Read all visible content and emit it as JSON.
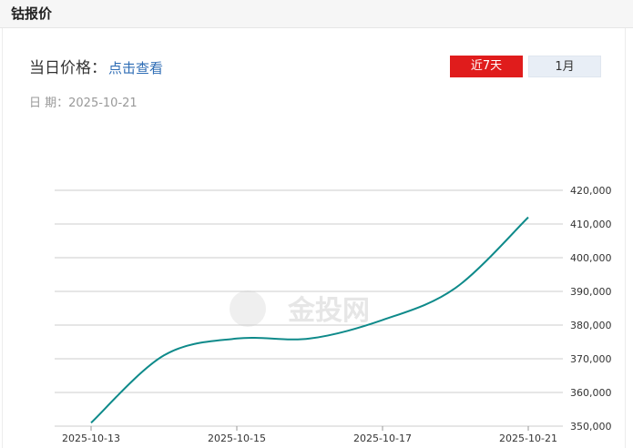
{
  "header": {
    "title": "钴报价"
  },
  "price": {
    "label": "当日价格：",
    "link": "点击查看"
  },
  "date": {
    "label": "日 期：",
    "value": "2025-10-21"
  },
  "range_buttons": [
    {
      "label": "近7天",
      "active": true
    },
    {
      "label": "1月",
      "active": false
    }
  ],
  "watermark": {
    "text": "金投网"
  },
  "colors": {
    "line": "#0e8a8a",
    "active": "#e01c1c",
    "link": "#2f6db5"
  },
  "chart_data": {
    "type": "line",
    "title": "",
    "xlabel": "",
    "ylabel": "",
    "x": [
      "2025-10-13",
      "2025-10-14",
      "2025-10-15",
      "2025-10-16",
      "2025-10-17",
      "2025-10-20",
      "2025-10-21"
    ],
    "x_ticks": [
      "2025-10-13",
      "2025-10-15",
      "2025-10-17",
      "2025-10-21"
    ],
    "series": [
      {
        "values": [
          351000,
          371000,
          376000,
          376000,
          381500,
          391000,
          412000
        ]
      }
    ],
    "y_ticks": [
      "420,000",
      "410,000",
      "400,000",
      "390,000",
      "380,000",
      "370,000",
      "360,000",
      "350,000"
    ],
    "ylim": [
      350000,
      420000
    ],
    "y_axis": "right",
    "grid": true
  }
}
